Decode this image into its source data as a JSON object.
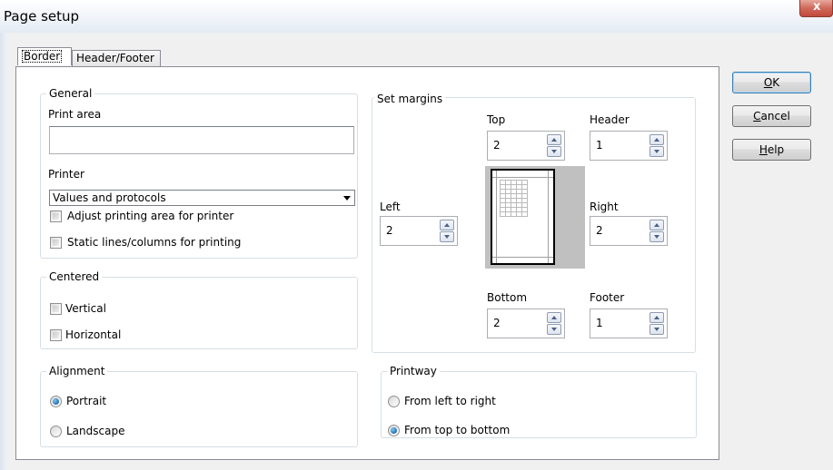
{
  "window": {
    "title": "Page setup",
    "close_label": "x"
  },
  "tabs": [
    {
      "label": "Border",
      "active": true
    },
    {
      "label": "Header/Footer",
      "active": false
    }
  ],
  "buttons": {
    "ok": {
      "label": "OK",
      "mnemonic": "O"
    },
    "cancel": {
      "label": "Cancel",
      "mnemonic": "C"
    },
    "help": {
      "label": "Help",
      "mnemonic": "H"
    }
  },
  "general": {
    "title": "General",
    "print_area_label": "Print area",
    "print_area_value": "",
    "printer_label": "Printer",
    "printer_value": "Values and protocols",
    "adjust_label": "Adjust printing area for printer",
    "adjust_checked": false,
    "static_label": "Static lines/columns for printing",
    "static_checked": false
  },
  "centered": {
    "title": "Centered",
    "vertical_label": "Vertical",
    "vertical_checked": false,
    "horizontal_label": "Horizontal",
    "horizontal_checked": false
  },
  "margins": {
    "title": "Set margins",
    "top_label": "Top",
    "top_value": "2",
    "header_label": "Header",
    "header_value": "1",
    "left_label": "Left",
    "left_value": "2",
    "right_label": "Right",
    "right_value": "2",
    "bottom_label": "Bottom",
    "bottom_value": "2",
    "footer_label": "Footer",
    "footer_value": "1"
  },
  "alignment": {
    "title": "Alignment",
    "portrait_label": "Portrait",
    "landscape_label": "Landscape",
    "selected": "Portrait"
  },
  "printway": {
    "title": "Printway",
    "ltr_label": "From left to right",
    "ttb_label": "From top to bottom",
    "selected": "From top to bottom"
  }
}
